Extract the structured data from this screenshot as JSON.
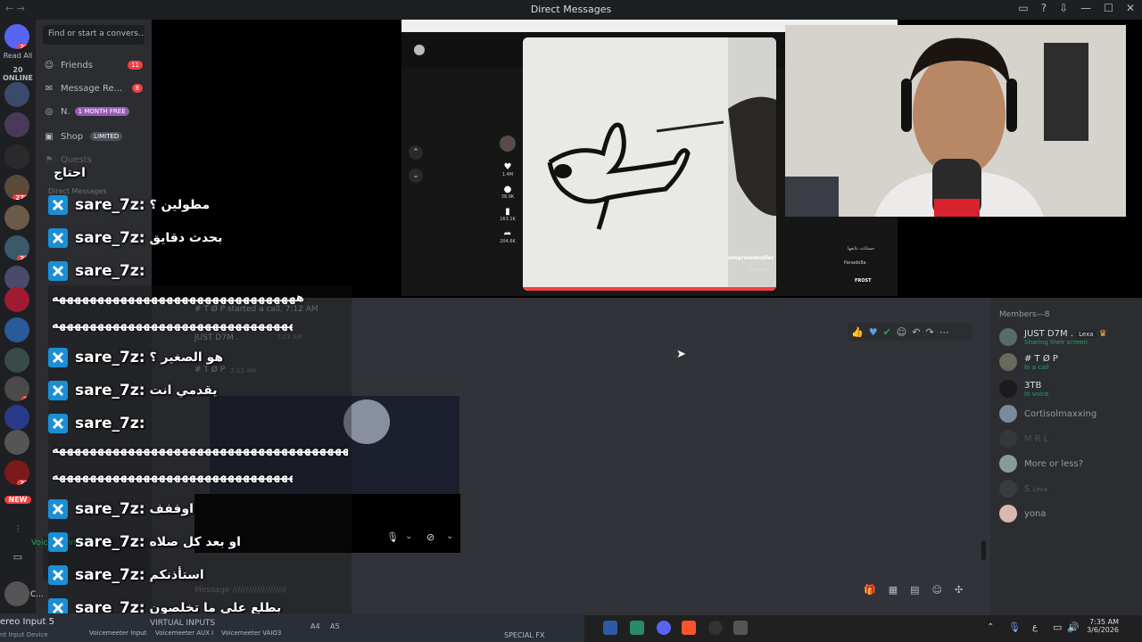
{
  "window": {
    "title": "Direct Messages",
    "nav": "← →",
    "controls": [
      "▭",
      "?",
      "⇩",
      "—",
      "☐",
      "✕"
    ]
  },
  "rail": {
    "read_all": "Read All",
    "online": "20 ONLINE",
    "badges": [
      "20",
      "279",
      "26",
      "5",
      "22"
    ],
    "new_label": "NEW"
  },
  "sidebar": {
    "search_placeholder": "Find or start a convers...",
    "items": [
      {
        "label": "Friends",
        "badge": "11",
        "icon": "friends-icon"
      },
      {
        "label": "Message Re...",
        "badge": "8",
        "icon": "message-requests-icon"
      },
      {
        "label": "N.",
        "tag": "1 MONTH FREE",
        "icon": "nitro-icon"
      },
      {
        "label": "Shop",
        "tag": "LIMITED",
        "icon": "shop-icon"
      },
      {
        "label": "Quests",
        "icon": "quests-icon"
      }
    ],
    "dm_header": "Direct Messages",
    "voice_connected": "Voice Connecte",
    "user_short": "C..."
  },
  "overlay_chat": [
    {
      "user": "sare_7z",
      "msg": "احتاج"
    },
    {
      "user": "sare_7z",
      "msg": "مطولين ؟"
    },
    {
      "user": "sare_7z",
      "msg": "بحدث دقايق"
    },
    {
      "user": "sare_7z",
      "msg": "ههههههههههههههههههههههههههههههههه"
    },
    {
      "user": "sare_7z",
      "msg": "هو الصغير ؟"
    },
    {
      "user": "sare_7z",
      "msg": "يقدمي انت"
    },
    {
      "user": "sare_7z",
      "msg": "ههههههههههههههههههههههههههههههههه"
    },
    {
      "user": "sare_7z",
      "msg": "اوففف"
    },
    {
      "user": "sare_7z",
      "msg": "او بعد كل صلاه"
    },
    {
      "user": "sare_7z",
      "msg": "استأذنكم"
    },
    {
      "user": "sare_7z",
      "msg": "بطلع على ما تخلصون"
    }
  ],
  "overlay_sep": " : ",
  "laugh_line": "ههههههههههههههههههههههههههههههههههههههههههههه",
  "laugh_line_2": "ههههههههههههههههههههههههههههههههههههههههه",
  "tiktok": {
    "handle": "omarvonmuller",
    "tag": "Sketching",
    "counts": [
      "1.4M",
      "38.9K",
      "163.1K",
      "204.6K"
    ],
    "right_label": "حسابات تتابعها",
    "right_user": "FROST",
    "right_user2": "Panado8a"
  },
  "chat_bg": {
    "call_started": "# T Ø P started a call. 7:12 AM",
    "just_d7m": "JUST D7M .",
    "time1": "7:13 AM",
    "top_name": "# T Ø P",
    "time2": "7:23 AM",
    "mellie": "Mellie",
    "yona": "yona",
    "message_placeholder": "Message ////////////////////"
  },
  "members": {
    "header": "Members—8",
    "list": [
      {
        "name": "JUST D7M .",
        "status": "Sharing their screen",
        "tag": "Lexa"
      },
      {
        "name": "# T Ø P",
        "status": "In a call"
      },
      {
        "name": "3TB",
        "status": "In voice"
      },
      {
        "name": "Cortisolmaxxing",
        "status": ""
      },
      {
        "name": "M R L",
        "status": ""
      },
      {
        "name": "More or less?",
        "status": ""
      },
      {
        "name": "S",
        "status": "",
        "tag": "Lexa"
      },
      {
        "name": "yona",
        "status": ""
      }
    ]
  },
  "taskbar": {
    "vm_left": "ereo Input 5",
    "vm_sub": "nt Input Device",
    "virtual_inputs": "VIRTUAL INPUTS",
    "vm_channels": [
      "Voicemeeter Input",
      "Voicemeeter AUX I",
      "Voicemeeter VAIO3"
    ],
    "a_buttons": [
      "A4",
      "A5"
    ],
    "special_fx": "SPECIAL FX",
    "lang": "ع",
    "time": "7:35 AM",
    "date": "3/6/2026"
  },
  "colors": {
    "accent": "#5865f2",
    "danger": "#f23f43",
    "online": "#23a55a",
    "xbox": "#1a8fd6"
  }
}
